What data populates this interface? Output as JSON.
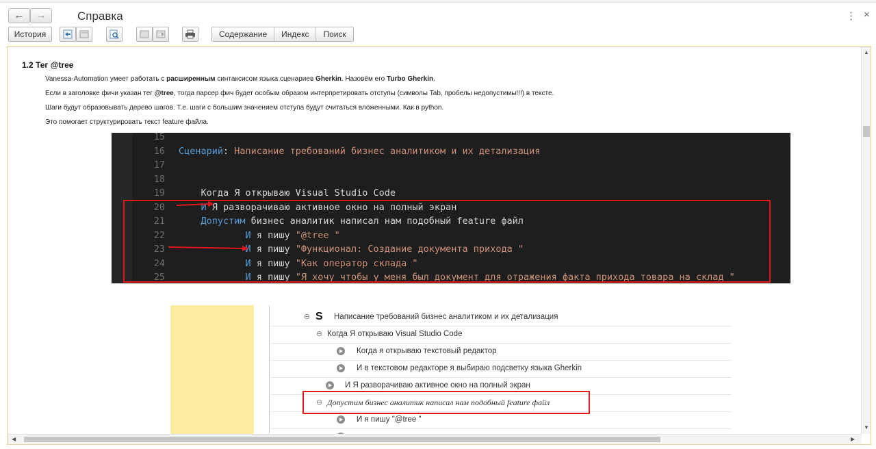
{
  "window": {
    "title": "Справка",
    "back_icon": "←",
    "forward_icon": "→",
    "menu_icon": "⋮",
    "close_icon": "×"
  },
  "toolbar": {
    "history_label": "История",
    "tabs": [
      "Содержание",
      "Индекс",
      "Поиск"
    ]
  },
  "doc": {
    "heading": "1.2 Тег @tree",
    "p1": {
      "a": "Vanessa-Automation умеет работать с ",
      "b1": "расширенным",
      "c": " синтаксисом языка сценариев ",
      "b2": "Gherkin",
      "d": ". Назовём его ",
      "b3": "Turbo Gherkin",
      "e": "."
    },
    "p2": {
      "a": "Если в заголовке фичи указан тег ",
      "b1": "@tree",
      "c": ", тогда парсер фич будет особым образом интерпретировать отступы (символы Tab, пробелы недопустимы!!!) в тексте."
    },
    "p3": "Шаги будут образовывать дерево шагов. Т.е. шаги с большим значением отступа будут считаться вложенными. Как в python.",
    "p4": "Это помогает структурировать текст feature файла."
  },
  "code": {
    "lines": [
      {
        "n": "15",
        "indent": "",
        "kw": "",
        "rest": "",
        "str": ""
      },
      {
        "n": "16",
        "indent": "",
        "kw": "Сценарий",
        "rest": ": ",
        "str": "Написание требований бизнес аналитиком и их детализация"
      },
      {
        "n": "17",
        "indent": "",
        "kw": "",
        "rest": "",
        "str": ""
      },
      {
        "n": "18",
        "indent": "",
        "kw": "",
        "rest": "",
        "str": ""
      },
      {
        "n": "19",
        "indent": "    ",
        "kw": "",
        "rest": "Когда Я открываю Visual Studio Code",
        "str": ""
      },
      {
        "n": "20",
        "indent": "    ",
        "kw": "И",
        "rest": " Я разворачиваю активное окно на полный экран",
        "str": ""
      },
      {
        "n": "21",
        "indent": "    ",
        "kw": "Допустим",
        "rest": " бизнес аналитик написал нам подобный feature файл",
        "str": ""
      },
      {
        "n": "22",
        "indent": "            ",
        "kw": "И",
        "rest": " я пишу ",
        "str": "\"@tree \""
      },
      {
        "n": "23",
        "indent": "            ",
        "kw": "И",
        "rest": " я пишу ",
        "str": "\"Функционал: Создание документа прихода \""
      },
      {
        "n": "24",
        "indent": "            ",
        "kw": "И",
        "rest": " я пишу ",
        "str": "\"Как оператор склада \""
      },
      {
        "n": "25",
        "indent": "            ",
        "kw": "И",
        "rest": " я пишу ",
        "str": "\"Я хочу чтобы у меня был документ для отражения факта прихода товара на склад \""
      }
    ]
  },
  "tree": {
    "scenario_badge": "S",
    "rows": [
      "Написание требований бизнес аналитиком и их детализация",
      "Когда Я открываю Visual Studio Code",
      "Когда я открываю текстовый редактор",
      "И в текстовом редакторе я выбираю подсветку языка Gherkin",
      "И Я разворачиваю активное окно на полный экран",
      "Допустим бизнес аналитик написал нам подобный feature файл",
      "И я пишу \"@tree \""
    ]
  },
  "colors": {
    "code_bg": "#1e1e1e",
    "keyword": "#569cd6",
    "string": "#ce9178",
    "highlight": "#e0191d",
    "tree_panel": "#fbec9f"
  }
}
